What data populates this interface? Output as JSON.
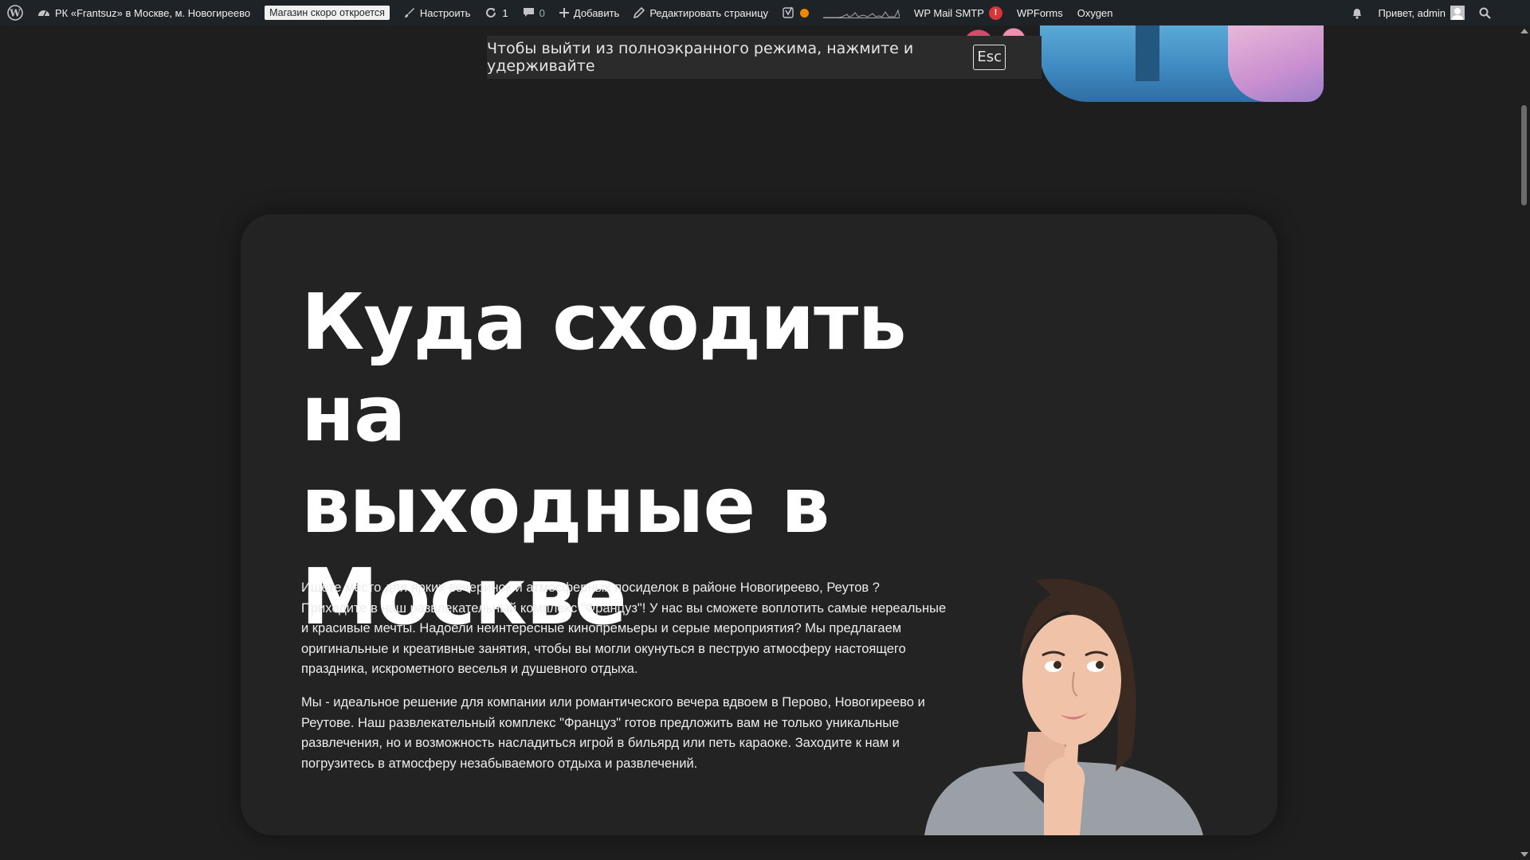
{
  "adminbar": {
    "site_name": "РК «Frantsuz» в Москве, м. Новогиреево",
    "store_badge": "Магазин скоро откроется",
    "customize": "Настроить",
    "updates_count": "1",
    "comments_count": "0",
    "add_new": "Добавить",
    "edit_page": "Редактировать страницу",
    "wp_mail_smtp": "WP Mail SMTP",
    "wp_mail_smtp_alert": "!",
    "wpforms": "WPForms",
    "oxygen": "Oxygen",
    "greeting": "Привет, admin",
    "colors": {
      "bar": "#1d2327",
      "status_dot": "#f18500",
      "alert": "#d63638"
    }
  },
  "toast": {
    "message": "Чтобы выйти из полноэкранного режима, нажмите и удерживайте",
    "key": "Esc"
  },
  "content": {
    "heading_lines": [
      "Куда сходить на",
      "выходные в",
      "Москве"
    ],
    "paragraph1": "Ищете место для ярких вечеринок и атмосферных посиделок в районе Новогиреево, Реутов ? Приходите в наш развлекательный комплекс \"Француз\"! У нас вы сможете воплотить самые нереальные и красивые мечты. Надоели неинтересные кинопремьеры и серые мероприятия? Мы предлагаем оригинальные и креативные занятия, чтобы вы могли окунуться в пеструю атмосферу настоящего праздника, искрометного веселья и душевного отдыха.",
    "paragraph2": "Мы - идеальное решение для компании или романтического вечера вдвоем в Перово, Новогиреево и Реутове. Наш развлекательный комплекс \"Француз\" готов предложить вам не только уникальные развлечения, но и возможность насладиться игрой в бильярд или петь караоке. Заходите к нам и погрузитесь в атмосферу незабываемого отдыха и развлечений."
  }
}
